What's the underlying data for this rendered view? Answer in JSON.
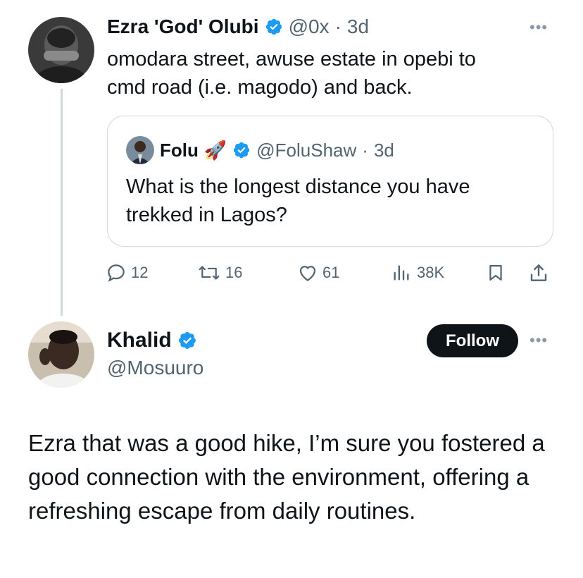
{
  "tweet": {
    "author_name": "Ezra 'God' Olubi",
    "handle": "@0x",
    "separator": "·",
    "time": "3d",
    "text_line1": "omodara street, awuse estate in opebi to",
    "text_line2": "cmd road (i.e. magodo) and back.",
    "more_icon": "more-horizontal-icon"
  },
  "quoted": {
    "author_name": "Folu",
    "emoji": "🚀",
    "handle": "@FoluShaw",
    "separator": "·",
    "time": "3d",
    "text_line1": "What is the longest distance you have",
    "text_line2": "trekked in Lagos?"
  },
  "actions": {
    "replies": "12",
    "retweets": "16",
    "likes": "61",
    "views": "38K"
  },
  "reply": {
    "author_name": "Khalid",
    "handle": "@Mosuuro",
    "follow_label": "Follow",
    "text": "Ezra that was a good hike, I’m sure you fostered a good connection with the environment, offering a refreshing escape from daily routines."
  },
  "colors": {
    "verified": "#1d9bf0",
    "muted": "#536471",
    "border": "#cfd9de",
    "follow_bg": "#0f1419"
  }
}
